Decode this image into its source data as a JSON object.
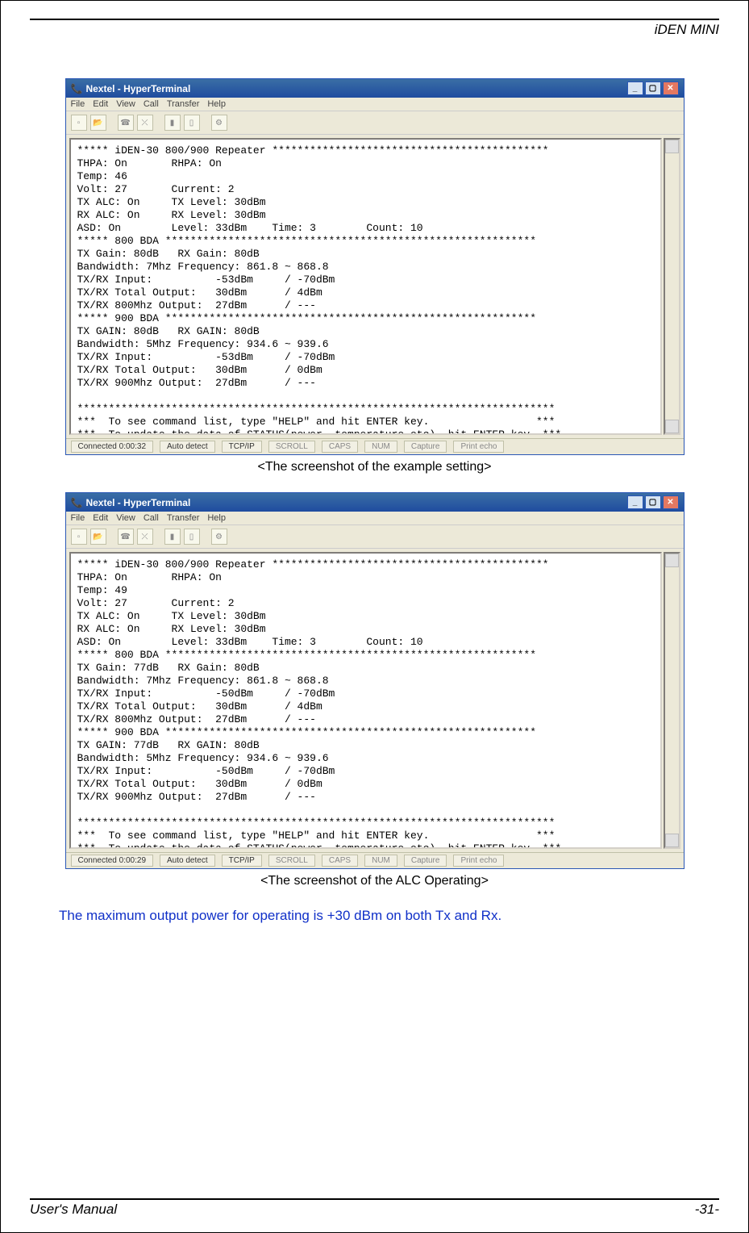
{
  "header": {
    "model": "iDEN MINI"
  },
  "footer": {
    "left": "User's Manual",
    "right": "-31-"
  },
  "captions": {
    "s1": "<The screenshot of the example setting>",
    "s2": "<The screenshot of the ALC Operating>"
  },
  "note": "The maximum output power for operating is +30 dBm on both Tx and Rx.",
  "ht_common": {
    "title_prefix": "Nextel - HyperTerminal",
    "menus": [
      "File",
      "Edit",
      "View",
      "Call",
      "Transfer",
      "Help"
    ],
    "status_inactive": [
      "SCROLL",
      "CAPS",
      "NUM",
      "Capture",
      "Print echo"
    ],
    "status_auto": "Auto detect",
    "status_proto": "TCP/IP"
  },
  "screens": [
    {
      "conn_time": "Connected 0:00:32",
      "term": "***** iDEN-30 800/900 Repeater ********************************************\nTHPA: On       RHPA: On\nTemp: 46\nVolt: 27       Current: 2\nTX ALC: On     TX Level: 30dBm\nRX ALC: On     RX Level: 30dBm\nASD: On        Level: 33dBm    Time: 3        Count: 10\n***** 800 BDA ***********************************************************\nTX Gain: 80dB   RX Gain: 80dB\nBandwidth: 7Mhz Frequency: 861.8 ~ 868.8\nTX/RX Input:          -53dBm     / -70dBm\nTX/RX Total Output:   30dBm      / 4dBm\nTX/RX 800Mhz Output:  27dBm      / ---\n***** 900 BDA ***********************************************************\nTX GAIN: 80dB   RX GAIN: 80dB\nBandwidth: 5Mhz Frequency: 934.6 ~ 939.6\nTX/RX Input:          -53dBm     / -70dBm\nTX/RX Total Output:   30dBm      / 0dBm\nTX/RX 900Mhz Output:  27dBm      / ---\n\n****************************************************************************\n***  To see command list, type \"HELP\" and hit ENTER key.                 ***\n***  To update the data of STATUS(power, temperature etc), hit ENTER key. ***\n>>_"
    },
    {
      "conn_time": "Connected 0:00:29",
      "term": "***** iDEN-30 800/900 Repeater ********************************************\nTHPA: On       RHPA: On\nTemp: 49\nVolt: 27       Current: 2\nTX ALC: On     TX Level: 30dBm\nRX ALC: On     RX Level: 30dBm\nASD: On        Level: 33dBm    Time: 3        Count: 10\n***** 800 BDA ***********************************************************\nTX Gain: 77dB   RX Gain: 80dB\nBandwidth: 7Mhz Frequency: 861.8 ~ 868.8\nTX/RX Input:          -50dBm     / -70dBm\nTX/RX Total Output:   30dBm      / 4dBm\nTX/RX 800Mhz Output:  27dBm      / ---\n***** 900 BDA ***********************************************************\nTX GAIN: 77dB   RX GAIN: 80dB\nBandwidth: 5Mhz Frequency: 934.6 ~ 939.6\nTX/RX Input:          -50dBm     / -70dBm\nTX/RX Total Output:   30dBm      / 0dBm\nTX/RX 900Mhz Output:  27dBm      / ---\n\n****************************************************************************\n***  To see command list, type \"HELP\" and hit ENTER key.                 ***\n***  To update the data of STATUS(power, temperature etc), hit ENTER key. ***\n>>"
    }
  ]
}
